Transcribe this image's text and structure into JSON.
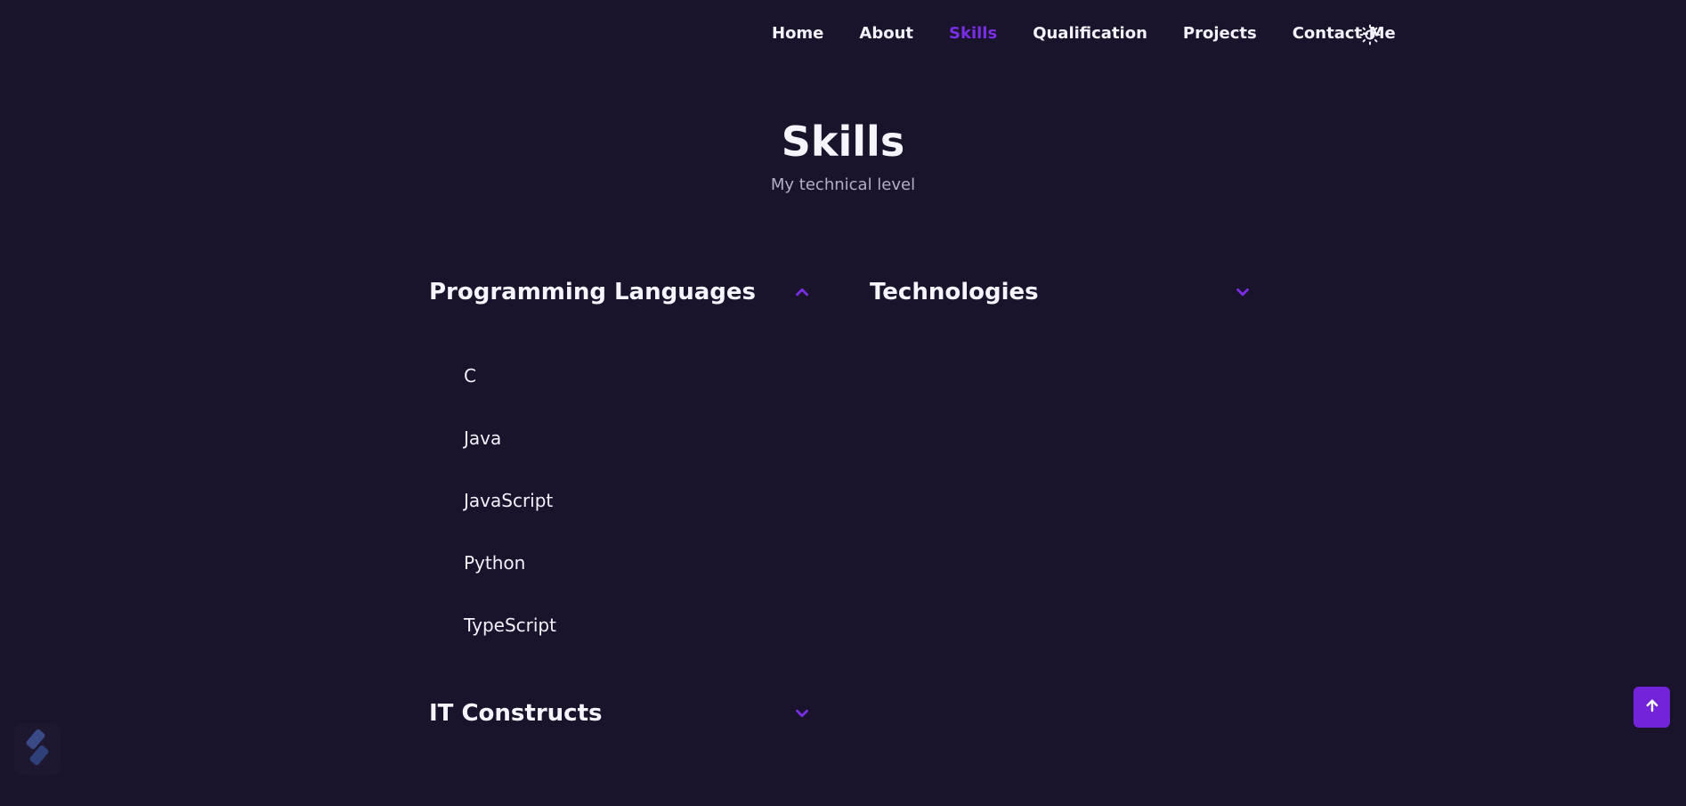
{
  "nav": {
    "items": [
      {
        "label": "Home",
        "active": false
      },
      {
        "label": "About",
        "active": false
      },
      {
        "label": "Skills",
        "active": true
      },
      {
        "label": "Qualification",
        "active": false
      },
      {
        "label": "Projects",
        "active": false
      },
      {
        "label": "Contact-Me",
        "active": false
      }
    ],
    "theme_toggle_icon": "sun-icon"
  },
  "section": {
    "title": "Skills",
    "subtitle": "My technical level"
  },
  "skill_groups": [
    {
      "title": "Programming Languages",
      "expanded": true,
      "chevron_icon": "chevron-up-icon",
      "items": [
        "C",
        "Java",
        "JavaScript",
        "Python",
        "TypeScript"
      ]
    },
    {
      "title": "Technologies",
      "expanded": false,
      "chevron_icon": "chevron-down-icon",
      "items": []
    },
    {
      "title": "IT Constructs",
      "expanded": false,
      "chevron_icon": "chevron-down-icon",
      "items": []
    }
  ],
  "scroll_up_icon": "arrow-up-icon",
  "badge_icon": "logo-icon",
  "colors": {
    "background": "#19132b",
    "accent": "#7a2ee6",
    "text": "#f3f1fb",
    "subtitle": "#b3aec8"
  }
}
